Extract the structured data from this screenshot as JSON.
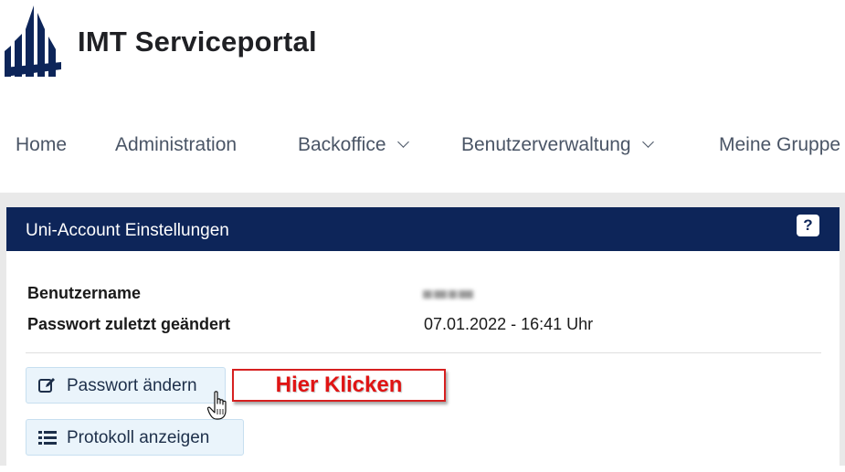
{
  "header": {
    "title": "IMT Serviceportal",
    "logo_icon": "university-logo-icon",
    "brand_color": "#0d2559"
  },
  "nav": {
    "items": [
      {
        "label": "Home",
        "has_dropdown": false
      },
      {
        "label": "Administration",
        "has_dropdown": false
      },
      {
        "label": "Backoffice",
        "has_dropdown": true
      },
      {
        "label": "Benutzerverwaltung",
        "has_dropdown": true
      },
      {
        "label": "Meine Gruppe",
        "has_dropdown": false
      }
    ]
  },
  "panel": {
    "title": "Uni-Account Einstellungen",
    "help_label": "?",
    "fields": [
      {
        "label": "Benutzername",
        "value": "",
        "value_blurred": true
      },
      {
        "label": "Passwort zuletzt geändert",
        "value": "07.01.2022 - 16:41 Uhr"
      }
    ],
    "buttons": {
      "change_password": {
        "label": "Passwort ändern",
        "icon": "edit-icon"
      },
      "show_log": {
        "label": "Protokoll anzeigen",
        "icon": "list-icon"
      }
    }
  },
  "annotation": {
    "callout_text": "Hier Klicken",
    "callout_color": "#e01414",
    "cursor_icon": "hand-pointer-icon"
  }
}
